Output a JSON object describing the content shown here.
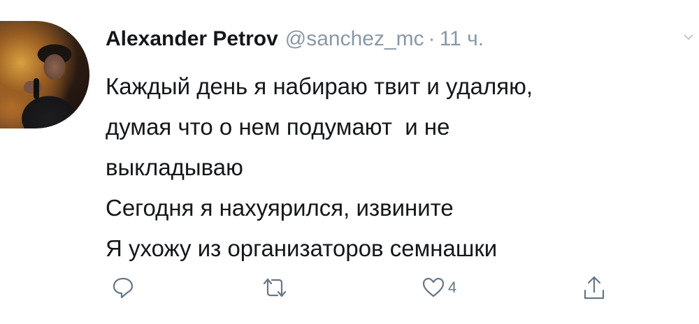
{
  "tweet": {
    "display_name": "Alexander Petrov",
    "handle": "@sanchez_mc",
    "separator": "·",
    "time": "11 ч.",
    "lines": [
      "Каждый день я набираю твит и удаляю,",
      "думая что о нем подумают  и не",
      "выкладываю",
      "Сегодня я нахуярился, извините",
      "Я ухожу из организаторов семнашки"
    ],
    "actions": {
      "reply_icon": "reply-icon",
      "retweet_icon": "retweet-icon",
      "like_icon": "heart-icon",
      "like_count": "4",
      "share_icon": "share-icon"
    }
  },
  "colors": {
    "text": "#14171a",
    "secondary": "#8899a6",
    "icon": "#657786"
  }
}
